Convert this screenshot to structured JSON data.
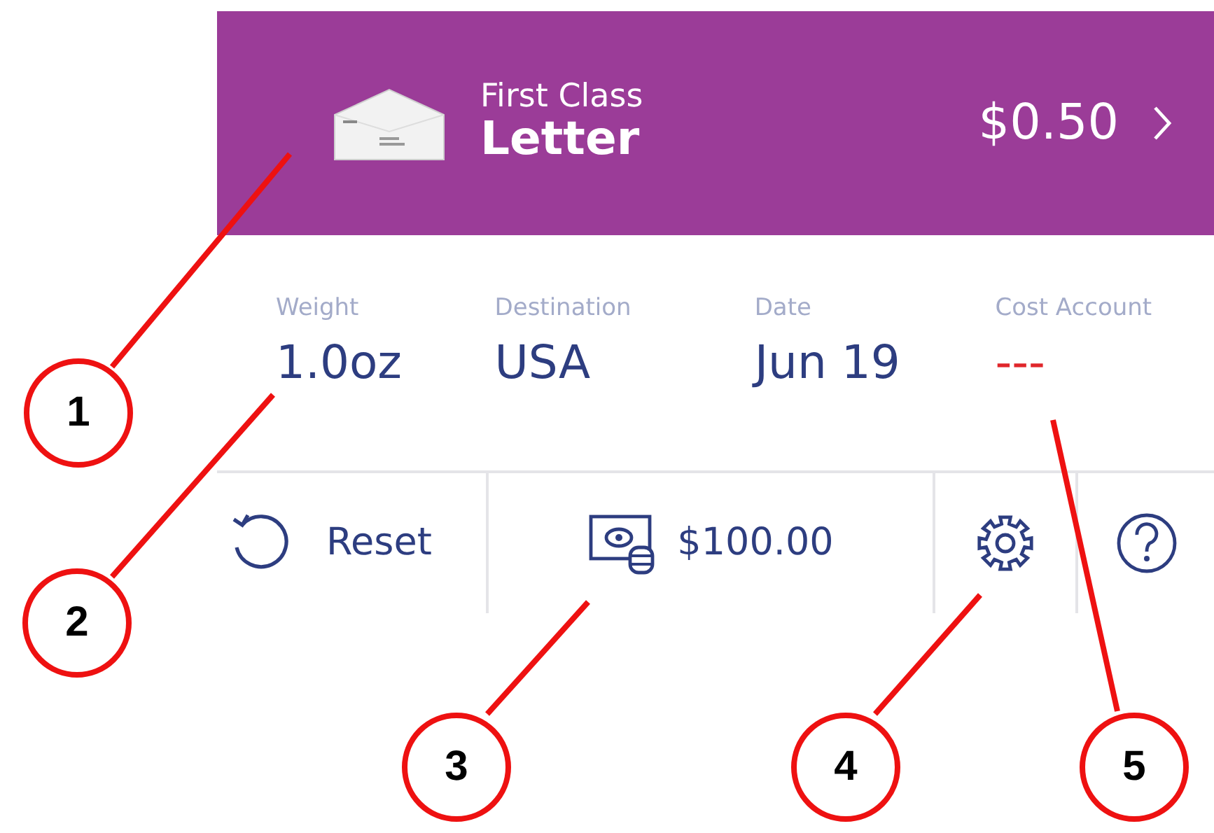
{
  "banner": {
    "service": "First Class",
    "mail_type": "Letter",
    "price": "$0.50"
  },
  "fields": [
    {
      "label": "Weight",
      "value": "1.0oz",
      "kind": "set"
    },
    {
      "label": "Destination",
      "value": "USA",
      "kind": "set"
    },
    {
      "label": "Date",
      "value": "Jun 19",
      "kind": "set"
    },
    {
      "label": "Cost Account",
      "value": "---",
      "kind": "unset"
    }
  ],
  "actions": {
    "reset": "Reset",
    "balance": "$100.00"
  },
  "callouts": [
    {
      "number": "1"
    },
    {
      "number": "2"
    },
    {
      "number": "3"
    },
    {
      "number": "4"
    },
    {
      "number": "5"
    }
  ]
}
